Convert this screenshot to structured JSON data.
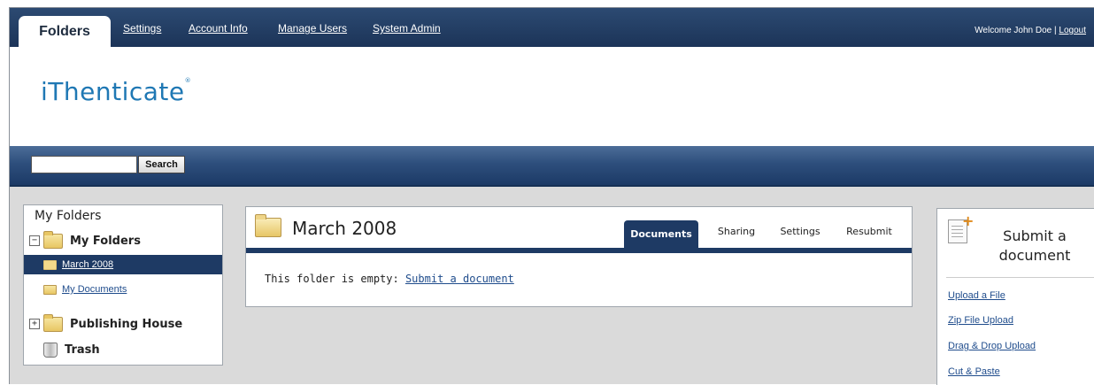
{
  "topnav": {
    "active_tab": "Folders",
    "links": [
      "Settings",
      "Account Info",
      "Manage Users",
      "System Admin"
    ],
    "welcome_text": "Welcome John Doe |",
    "logout_label": "Logout"
  },
  "brand": {
    "logo_text": "iThenticate",
    "logo_mark": "®"
  },
  "search": {
    "value": "",
    "button_label": "Search"
  },
  "sidebar": {
    "title": "My Folders",
    "root_folder": "My Folders",
    "subfolders": [
      "March 2008",
      "My Documents"
    ],
    "selected": "March 2008",
    "other_folder": "Publishing House",
    "trash_label": "Trash"
  },
  "panel": {
    "title": "March 2008",
    "tabs": [
      "Documents",
      "Sharing",
      "Settings",
      "Resubmit"
    ],
    "active_tab": "Documents",
    "empty_text": "This folder is empty:",
    "empty_link": "Submit a document"
  },
  "submit_box": {
    "title_line1": "Submit a",
    "title_line2": "document",
    "links": [
      "Upload a File",
      "Zip File Upload",
      "Drag & Drop Upload",
      "Cut & Paste"
    ]
  },
  "colors": {
    "nav_bg": "#1c3458",
    "accent": "#1e3a64",
    "link": "#1f4c8c",
    "logo": "#1f78b4"
  }
}
